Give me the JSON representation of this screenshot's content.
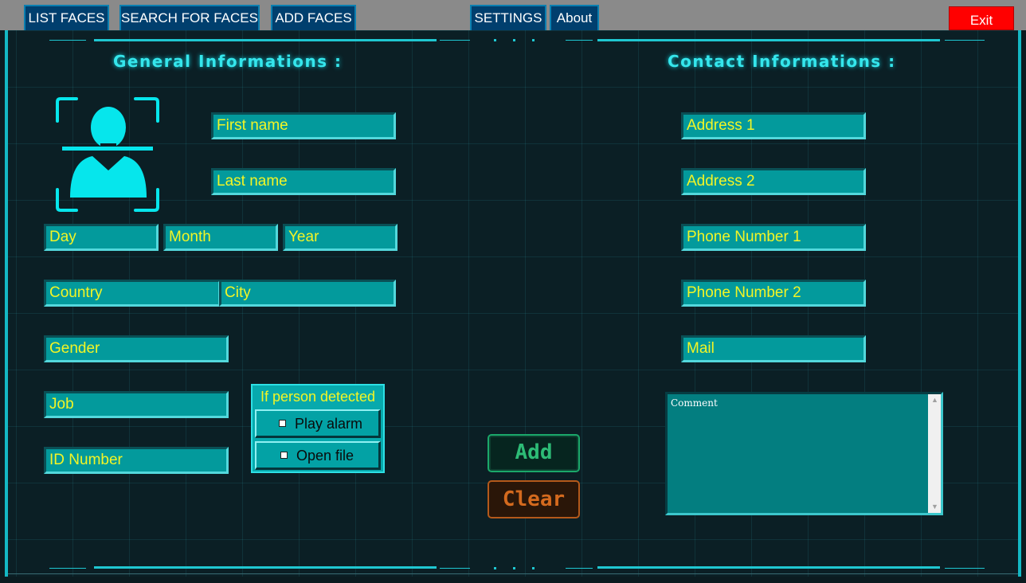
{
  "menu": {
    "list_faces": "LIST FACES",
    "search_faces": "SEARCH FOR FACES",
    "add_faces": "ADD FACES",
    "settings": "SETTINGS",
    "about": "About",
    "exit": "Exit"
  },
  "general": {
    "title": "General Informations :",
    "first_name": "First name",
    "last_name": "Last name",
    "day": "Day",
    "month": "Month",
    "year": "Year",
    "country": "Country",
    "city": "City",
    "gender": "Gender",
    "job": "Job",
    "id_number": "ID Number"
  },
  "detection": {
    "title": "If person detected",
    "play_alarm": "Play alarm",
    "open_file": "Open file",
    "play_alarm_checked": false,
    "open_file_checked": false
  },
  "contact": {
    "title": "Contact Informations :",
    "address1": "Address 1",
    "address2": "Address 2",
    "phone1": "Phone Number 1",
    "phone2": "Phone Number 2",
    "mail": "Mail",
    "comment": "Comment"
  },
  "actions": {
    "add": "Add",
    "clear": "Clear"
  },
  "colors": {
    "accent": "#1fc7d1",
    "field_bg": "#039a9c",
    "field_text": "#f3f525",
    "exit": "#ff0000",
    "add": "#2dbb76",
    "clear": "#d46a1e"
  },
  "icons": {
    "avatar": "face-scan-icon"
  }
}
